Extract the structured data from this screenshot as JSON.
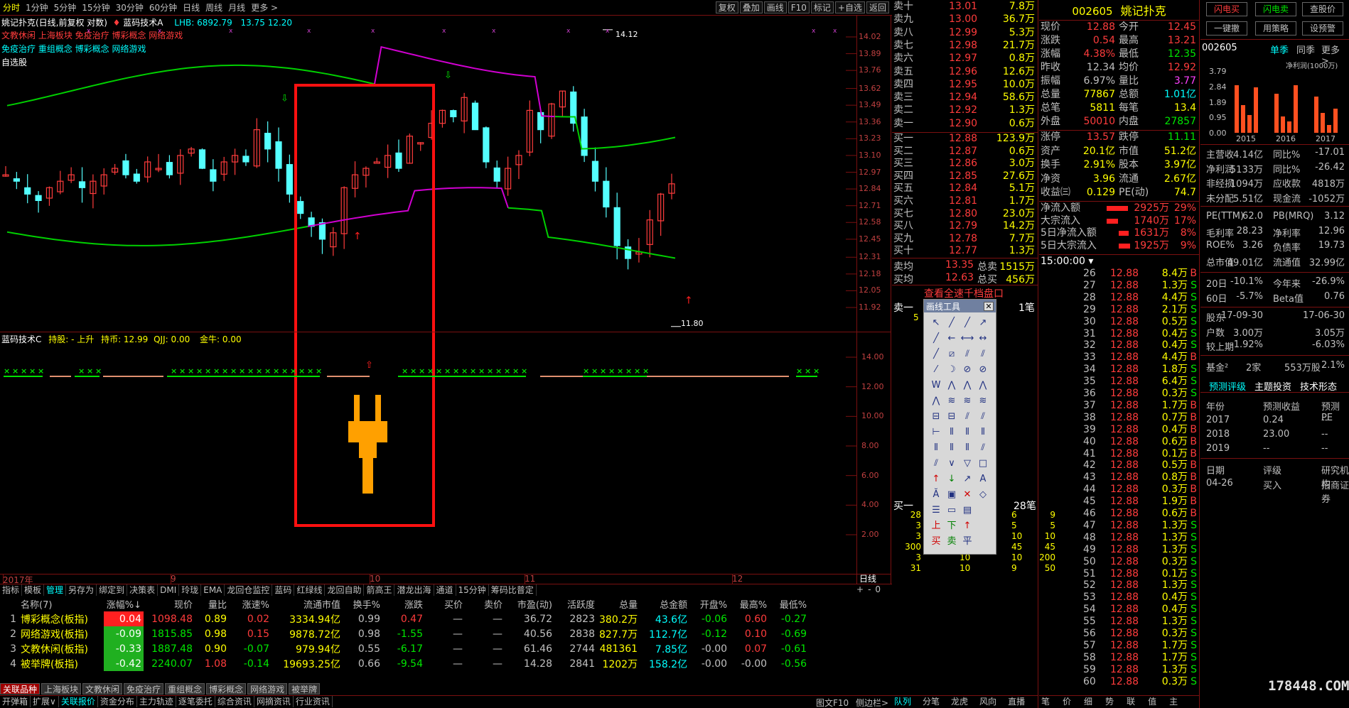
{
  "top": {
    "timeframes": [
      "分时",
      "1分钟",
      "5分钟",
      "15分钟",
      "30分钟",
      "60分钟",
      "日线",
      "周线",
      "月线",
      "更多 >"
    ],
    "tools": [
      "复权",
      "叠加",
      "画线",
      "F10",
      "标记",
      "+自选",
      "返回"
    ]
  },
  "chart": {
    "header": "姚记扑克(日线,前复权 对数)",
    "indicator": "蓝码技术A",
    "lhb": "LHB: 6892.79",
    "hl": "13.75   12.20",
    "line1": "文教休闲 上海板块 免疫治疗 博彩概念 网络游戏",
    "line2": "免疫治疗 重组概念 博彩概念 网络游戏",
    "line3": "自选股",
    "max_label": "14.12",
    "min_label": "11.80",
    "yticks": [
      "14.02",
      "13.89",
      "13.76",
      "13.62",
      "13.49",
      "13.36",
      "13.23",
      "13.10",
      "12.97",
      "12.84",
      "12.71",
      "12.58",
      "12.45",
      "12.31",
      "12.18",
      "12.05",
      "11.92"
    ]
  },
  "sub": {
    "title": "蓝码技术C",
    "hold": "持股: - 上升",
    "hold_price": "持币: 12.99",
    "qjj": "QJJ: 0.00",
    "jinniu": "金牛: 0.00",
    "yticks": [
      "14.00",
      "12.00",
      "10.00",
      "8.00",
      "6.00",
      "4.00",
      "2.00"
    ]
  },
  "xaxis": {
    "labels": [
      "2017年",
      "9",
      "10",
      "11",
      "12"
    ],
    "right": "日线"
  },
  "tabs": [
    "指标",
    "模板",
    "管理",
    "另存为",
    "绑定到",
    "决策表",
    "DMI",
    "玲珑",
    "EMA",
    "龙回仓监控",
    "蓝码",
    "红绿线",
    "龙回自助",
    "箭高王",
    "潜龙出海",
    "通道",
    "15分钟",
    "筹码比普定"
  ],
  "table": {
    "headers": [
      "",
      "名称(7)",
      "涨幅%↓",
      "现价",
      "量比",
      "涨速%",
      "流通市值",
      "换手%",
      "涨跌",
      "买价",
      "卖价",
      "市盈(动)",
      "活跃度",
      "总量",
      "总金额",
      "开盘%",
      "最高%",
      "最低%"
    ],
    "rows": [
      [
        "1",
        "博彩概念(板指)",
        "0.04",
        "1098.48",
        "0.89",
        "0.02",
        "3334.94亿",
        "0.99",
        "0.47",
        "—",
        "—",
        "36.72",
        "2823",
        "380.2万",
        "43.6亿",
        "-0.06",
        "0.60",
        "-0.27"
      ],
      [
        "2",
        "网络游戏(板指)",
        "-0.09",
        "1815.85",
        "0.98",
        "0.15",
        "9878.72亿",
        "0.98",
        "-1.55",
        "—",
        "—",
        "40.56",
        "2838",
        "827.7万",
        "112.7亿",
        "-0.12",
        "0.10",
        "-0.69"
      ],
      [
        "3",
        "文教休闲(板指)",
        "-0.33",
        "1887.48",
        "0.90",
        "-0.07",
        "979.94亿",
        "0.55",
        "-6.17",
        "—",
        "—",
        "61.46",
        "2744",
        "481361",
        "7.85亿",
        "-0.00",
        "0.07",
        "-0.61"
      ],
      [
        "4",
        "被举牌(板指)",
        "-0.42",
        "2240.07",
        "1.08",
        "-0.14",
        "19693.25亿",
        "0.66",
        "-9.54",
        "—",
        "—",
        "14.28",
        "2841",
        "1202万",
        "158.2亿",
        "-0.00",
        "-0.00",
        "-0.56"
      ]
    ]
  },
  "bottom_tabs": [
    "关联品种",
    "上海板块",
    "文教休闲",
    "免疫治疗",
    "重组概念",
    "博彩概念",
    "网络游戏",
    "被举牌"
  ],
  "status": [
    "开弹箱",
    "扩展∨",
    "关联报价",
    "资金分布",
    "主力轨迹",
    "逐笔委托",
    "综合资讯",
    "网摘资讯",
    "行业资讯"
  ],
  "status_right": [
    "图文F10",
    "侧边栏>"
  ],
  "orderbook": {
    "asks": [
      [
        "卖十",
        "13.01",
        "7.8万"
      ],
      [
        "卖九",
        "13.00",
        "36.7万"
      ],
      [
        "卖八",
        "12.99",
        "5.3万"
      ],
      [
        "卖七",
        "12.98",
        "21.7万"
      ],
      [
        "卖六",
        "12.97",
        "0.8万"
      ],
      [
        "卖五",
        "12.96",
        "12.6万"
      ],
      [
        "卖四",
        "12.95",
        "10.0万"
      ],
      [
        "卖三",
        "12.94",
        "58.6万"
      ],
      [
        "卖二",
        "12.92",
        "1.3万"
      ],
      [
        "卖一",
        "12.90",
        "0.6万"
      ]
    ],
    "bids": [
      [
        "买一",
        "12.88",
        "123.9万"
      ],
      [
        "买二",
        "12.87",
        "0.6万"
      ],
      [
        "买三",
        "12.86",
        "3.0万"
      ],
      [
        "买四",
        "12.85",
        "27.6万"
      ],
      [
        "买五",
        "12.84",
        "5.1万"
      ],
      [
        "买六",
        "12.81",
        "1.7万"
      ],
      [
        "买七",
        "12.80",
        "23.0万"
      ],
      [
        "买八",
        "12.79",
        "14.2万"
      ],
      [
        "买九",
        "12.78",
        "7.7万"
      ],
      [
        "买十",
        "12.77",
        "1.3万"
      ]
    ],
    "avg_ask": [
      "卖均",
      "13.35",
      "总卖",
      "1515万"
    ],
    "avg_bid": [
      "买均",
      "12.63",
      "总买",
      "456万"
    ],
    "link": "查看全速千档盘口",
    "sell1_label": "卖一",
    "sell1_qty": "1笔",
    "sell1_val": "5",
    "buy1_label": "买一",
    "buy1_qty": "28笔",
    "queue": [
      [
        "28",
        "10",
        "6",
        "9"
      ],
      [
        "3",
        "5",
        "5",
        "5"
      ],
      [
        "3",
        "5",
        "10",
        "10"
      ],
      [
        "300",
        "50",
        "45",
        "45"
      ],
      [
        "3",
        "10",
        "10",
        "200"
      ],
      [
        "31",
        "10",
        "9",
        "50"
      ]
    ]
  },
  "drawtool": {
    "title": "画线工具"
  },
  "quote": {
    "code": "002605",
    "name": "姚记扑克",
    "rows": [
      [
        "现价",
        "12.88",
        "今开",
        "12.45"
      ],
      [
        "涨跌",
        "0.54",
        "最高",
        "13.21"
      ],
      [
        "涨幅",
        "4.38%",
        "最低",
        "12.35"
      ],
      [
        "昨收",
        "12.34",
        "均价",
        "12.92"
      ],
      [
        "振幅",
        "6.97%",
        "量比",
        "3.77"
      ],
      [
        "总量",
        "77867",
        "总额",
        "1.01亿"
      ],
      [
        "总笔",
        "5811",
        "每笔",
        "13.4"
      ],
      [
        "外盘",
        "50010",
        "内盘",
        "27857"
      ]
    ],
    "rows2": [
      [
        "涨停",
        "13.57",
        "跌停",
        "11.11"
      ],
      [
        "资产",
        "20.1亿",
        "市值",
        "51.2亿"
      ],
      [
        "换手",
        "2.91%",
        "股本",
        "3.97亿"
      ],
      [
        "净资",
        "3.96",
        "流通",
        "2.67亿"
      ],
      [
        "收益㈢",
        "0.129",
        "PE(动)",
        "74.7"
      ]
    ],
    "flows": [
      [
        "净流入额",
        "2925万",
        "29%"
      ],
      [
        "大宗流入",
        "1740万",
        "17%"
      ],
      [
        "5日净流入额",
        "1631万",
        "8%"
      ],
      [
        "5日大宗流入",
        "1925万",
        "9%"
      ]
    ]
  },
  "ticks": {
    "header": "15:00:00",
    "rows": [
      [
        "26",
        "12.88",
        "8.4万",
        "B"
      ],
      [
        "27",
        "12.88",
        "1.3万",
        "S"
      ],
      [
        "28",
        "12.88",
        "4.4万",
        "S"
      ],
      [
        "29",
        "12.88",
        "2.1万",
        "S"
      ],
      [
        "30",
        "12.88",
        "0.5万",
        "S"
      ],
      [
        "31",
        "12.88",
        "0.4万",
        "S"
      ],
      [
        "32",
        "12.88",
        "0.4万",
        "S"
      ],
      [
        "33",
        "12.88",
        "4.4万",
        "B"
      ],
      [
        "34",
        "12.88",
        "1.8万",
        "S"
      ],
      [
        "35",
        "12.88",
        "6.4万",
        "S"
      ],
      [
        "36",
        "12.88",
        "0.3万",
        "S"
      ],
      [
        "37",
        "12.88",
        "1.7万",
        "B"
      ],
      [
        "38",
        "12.88",
        "0.7万",
        "B"
      ],
      [
        "39",
        "12.88",
        "0.4万",
        "B"
      ],
      [
        "40",
        "12.88",
        "0.6万",
        "B"
      ],
      [
        "41",
        "12.88",
        "0.1万",
        "B"
      ],
      [
        "42",
        "12.88",
        "0.5万",
        "B"
      ],
      [
        "43",
        "12.88",
        "0.8万",
        "B"
      ],
      [
        "44",
        "12.88",
        "0.3万",
        "B"
      ],
      [
        "45",
        "12.88",
        "1.9万",
        "B"
      ],
      [
        "46",
        "12.88",
        "0.6万",
        "B"
      ],
      [
        "47",
        "12.88",
        "1.3万",
        "S"
      ],
      [
        "48",
        "12.88",
        "1.3万",
        "S"
      ],
      [
        "49",
        "12.88",
        "1.3万",
        "S"
      ],
      [
        "50",
        "12.88",
        "0.3万",
        "S"
      ],
      [
        "51",
        "12.88",
        "0.1万",
        "S"
      ],
      [
        "52",
        "12.88",
        "1.3万",
        "S"
      ],
      [
        "53",
        "12.88",
        "0.4万",
        "S"
      ],
      [
        "54",
        "12.88",
        "0.4万",
        "S"
      ],
      [
        "55",
        "12.88",
        "1.3万",
        "S"
      ],
      [
        "56",
        "12.88",
        "0.3万",
        "S"
      ],
      [
        "57",
        "12.88",
        "1.7万",
        "S"
      ],
      [
        "58",
        "12.88",
        "1.7万",
        "S"
      ],
      [
        "59",
        "12.88",
        "1.3万",
        "S"
      ],
      [
        "60",
        "12.88",
        "0.3万",
        "S"
      ]
    ],
    "tabs": [
      "队列",
      "分笔",
      "龙虎",
      "风向",
      "直播",
      "笔",
      "价",
      "细",
      "势",
      "联",
      "值",
      "主"
    ]
  },
  "f10": {
    "buttons": [
      "闪电买",
      "闪电卖",
      "查股价",
      "一键撤",
      "用策略",
      "设预警"
    ],
    "code": "002605",
    "tab1": "单季",
    "tab2": "同季",
    "more": "更多 >",
    "chart_label": "净利润(1000万)",
    "years": [
      "2015",
      "2016",
      "2017"
    ],
    "yticks": [
      "3.79",
      "2.84",
      "1.89",
      "0.95",
      "0.00"
    ],
    "rows": [
      [
        "主营收",
        "4.14亿",
        "同比%",
        "-17.01"
      ],
      [
        "净利润",
        "5133万",
        "同比%",
        "-26.42"
      ],
      [
        "非经损",
        "1094万",
        "应收款",
        "4818万"
      ],
      [
        "未分配",
        "5.51亿",
        "现金流",
        "-1052万"
      ]
    ],
    "rows2": [
      [
        "PE(TTM)",
        "62.0",
        "PB(MRQ)",
        "3.12"
      ],
      [
        "毛利率",
        "28.23",
        "净利率",
        "12.96"
      ],
      [
        "ROE%",
        "3.26",
        "负债率",
        "19.73"
      ],
      [
        "总市值",
        "49.01亿",
        "流通值",
        "32.99亿"
      ]
    ],
    "rows3": [
      [
        "20日",
        "-10.1%",
        "今年来",
        "-26.9%"
      ],
      [
        "60日",
        "-5.7%",
        "Beta值",
        "0.76"
      ]
    ],
    "rows4": [
      [
        "股东",
        "17-09-30",
        "",
        "17-06-30"
      ],
      [
        "户数",
        "3.00万",
        "",
        "3.05万"
      ],
      [
        "较上期",
        "-1.92%",
        "",
        "-6.03%"
      ]
    ],
    "fund": [
      "基金²",
      "2家",
      "553万股",
      "2.1%"
    ],
    "tabs2": [
      "预测评级",
      "主题投资",
      "技术形态"
    ],
    "fc_head": [
      "年份",
      "预测收益",
      "预测PE"
    ],
    "fc": [
      [
        "2017",
        "0.24",
        "--"
      ],
      [
        "2018",
        "23.00",
        "--"
      ],
      [
        "2019",
        "--",
        "--"
      ]
    ],
    "rt_head": [
      "日期",
      "评级",
      "研究机构"
    ],
    "rt": [
      [
        "04-26",
        "买入",
        "招商证券"
      ]
    ]
  },
  "watermark": "178448.COM",
  "chart_data": {
    "type": "candlestick",
    "title": "姚记扑克(日线,前复权 对数)",
    "ylim": [
      11.8,
      14.12
    ],
    "max": 14.12,
    "min": 11.8
  }
}
